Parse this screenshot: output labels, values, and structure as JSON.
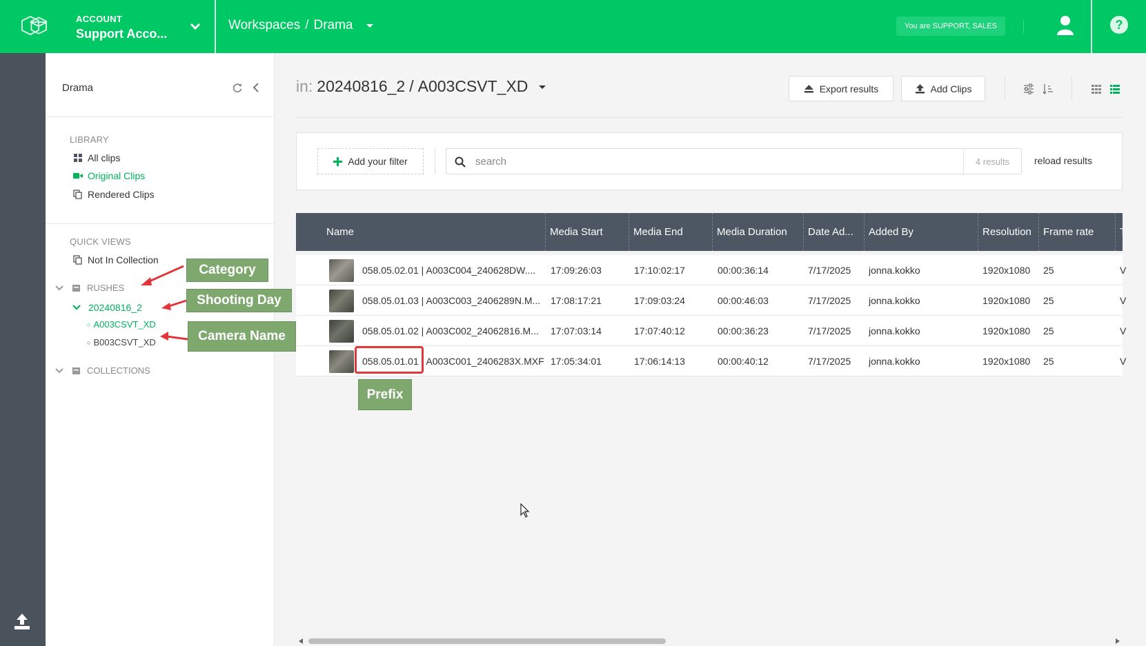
{
  "header": {
    "account_label": "ACCOUNT",
    "account_name": "Support Acco...",
    "breadcrumb": [
      "Workspaces",
      "/",
      "Drama"
    ],
    "role_badge": "You are SUPPORT, SALES",
    "icons": [
      "logo-icon",
      "chevron-down-icon",
      "user-icon",
      "help-icon"
    ]
  },
  "sidebar": {
    "title": "Drama",
    "library_label": "LIBRARY",
    "library_items": [
      {
        "label": "All clips",
        "icon": "grid-icon"
      },
      {
        "label": "Original Clips",
        "icon": "video-camera-icon",
        "active": true
      },
      {
        "label": "Rendered Clips",
        "icon": "copy-icon"
      }
    ],
    "quick_views_label": "QUICK VIEWS",
    "quick_views_items": [
      {
        "label": "Not In Collection",
        "icon": "copy-icon"
      }
    ],
    "rushes_label": "RUSHES",
    "shooting_day": "20240816_2",
    "cameras": [
      "A003CSVT_XD",
      "B003CSVT_XD"
    ],
    "collections_label": "COLLECTIONS"
  },
  "annotations": {
    "category": "Category",
    "shooting_day": "Shooting Day",
    "camera_name": "Camera Name",
    "prefix": "Prefix"
  },
  "main": {
    "title_in": "in:",
    "title_path": "20240816_2",
    "title_sep": "/",
    "title_current": "A003CSVT_XD",
    "export_label": "Export results",
    "add_clips_label": "Add Clips",
    "add_filter_label": "Add your filter",
    "search_placeholder": "search",
    "results_count": "4 results",
    "reload_label": "reload results"
  },
  "table": {
    "columns": [
      "Name",
      "Media Start",
      "Media End",
      "Media Duration",
      "Date Ad...",
      "Added By",
      "Resolution",
      "Frame rate",
      "T"
    ],
    "rows": [
      [
        "058.05.02.01 | A003C004_240628DW....",
        "17:09:26:03",
        "17:10:02:17",
        "00:00:36:14",
        "7/17/2025",
        "jonna.kokko",
        "1920x1080",
        "25",
        "V"
      ],
      [
        "058.05.01.03 | A003C003_2406289N.M...",
        "17:08:17:21",
        "17:09:03:24",
        "00:00:46:03",
        "7/17/2025",
        "jonna.kokko",
        "1920x1080",
        "25",
        "V"
      ],
      [
        "058.05.01.02 | A003C002_24062816.M...",
        "17:07:03:14",
        "17:07:40:12",
        "00:00:36:23",
        "7/17/2025",
        "jonna.kokko",
        "1920x1080",
        "25",
        "V"
      ],
      [
        "058.05.01.01 | A003C001_2406283X.MXF",
        "17:05:34:01",
        "17:06:14:13",
        "00:00:40:12",
        "7/17/2025",
        "jonna.kokko",
        "1920x1080",
        "25",
        "V"
      ]
    ]
  },
  "colors": {
    "brand_green": "#00c865",
    "rail": "#4a525c",
    "table_header": "#4d5663",
    "annotation": "#7fa86f",
    "annotation_arrow": "#e0373c"
  }
}
